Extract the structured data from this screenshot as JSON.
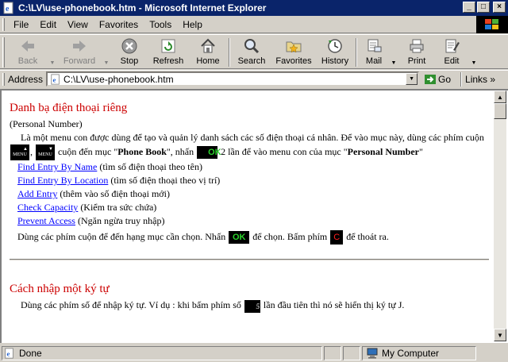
{
  "window": {
    "title": "C:\\LV\\use-phonebook.htm - Microsoft Internet Explorer",
    "controls": {
      "minimize": "_",
      "maximize": "□",
      "close": "×"
    }
  },
  "menu": [
    "File",
    "Edit",
    "View",
    "Favorites",
    "Tools",
    "Help"
  ],
  "toolbar": {
    "back": "Back",
    "forward": "Forward",
    "stop": "Stop",
    "refresh": "Refresh",
    "home": "Home",
    "search": "Search",
    "favorites": "Favorites",
    "history": "History",
    "mail": "Mail",
    "print": "Print",
    "edit": "Edit"
  },
  "address": {
    "label": "Address",
    "value": "C:\\LV\\use-phonebook.htm",
    "go": "Go",
    "links": "Links"
  },
  "page": {
    "section1": {
      "heading": "Danh bạ điện thoại riêng",
      "subtitle": "(Personal Number)",
      "intro_1": "Là một menu con được dùng để tạo và quản lý danh sách các số điện thoại cá nhân. Để vào mục này, dùng các phím cuộn",
      "key_up": "▲ MENU",
      "key_down": "▼ MENU",
      "intro_2": "cuộn đến mục \"",
      "phone_book": "Phone Book",
      "intro_3": "\", nhấn",
      "key_ok": "OK",
      "intro_4": "2 lần để vào menu con của mục \"",
      "personal_number": "Personal Number",
      "intro_5": "\"",
      "items": [
        {
          "link": "Find Entry By Name",
          "desc": "(tìm số điện thoại theo tên)"
        },
        {
          "link": "Find Entry By Location",
          "desc": "(tìm số điện thoại theo vị trí)"
        },
        {
          "link": "Add Entry",
          "desc": "(thêm vào số điện thoại mới)"
        },
        {
          "link": "Check Capacity",
          "desc": "(Kiểm tra sức chứa)"
        },
        {
          "link": "Prevent Access",
          "desc": "(Ngăn ngừa truy nhập)"
        }
      ],
      "outro_1": "Dùng các phím cuộn để đến hạng mục cần chọn. Nhấn",
      "outro_2": "để chọn. Bấm phím",
      "key_c": "C",
      "outro_3": "để thoát ra."
    },
    "section2": {
      "heading": "Cách nhập một ký tự",
      "text_1": "Dùng các phím số để nhập ký tự. Ví dụ : khi bấm phím số",
      "key_5": "5 JKL",
      "text_2": "lần đầu tiên thì nó sẽ hiển thị ký tự J."
    }
  },
  "status": {
    "text": "Done",
    "zone": "My Computer"
  }
}
